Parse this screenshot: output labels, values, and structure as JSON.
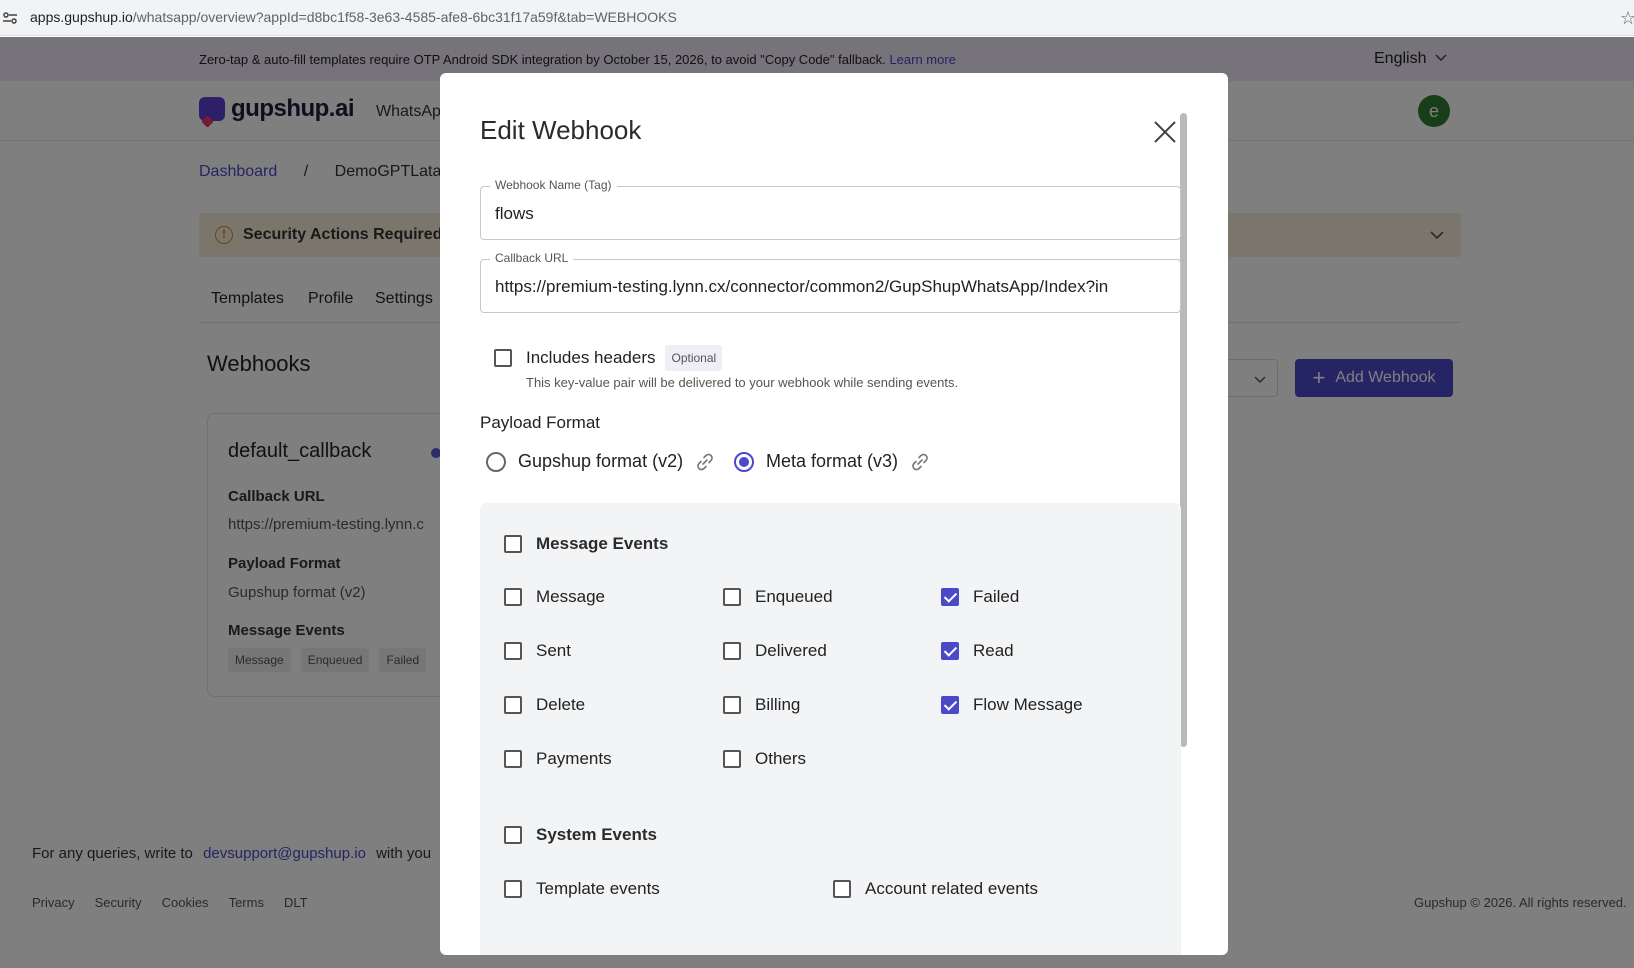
{
  "browser": {
    "url_host": "apps.gupshup.io",
    "url_path": "/whatsapp/overview?appId=d8bc1f58-3e63-4585-afe8-6bc31f17a59f&tab=WEBHOOKS"
  },
  "banner": {
    "message": "Zero-tap & auto-fill templates require OTP Android SDK integration by October 15, 2026, to avoid \"Copy Code\" fallback.",
    "link": "Learn more",
    "language": "English"
  },
  "nav": {
    "logo": "gupshup.ai",
    "link": "WhatsAp",
    "avatar_initial": "e"
  },
  "breadcrumb": {
    "root": "Dashboard",
    "separator": "/",
    "current": "DemoGPTLatan"
  },
  "security": {
    "label": "Security Actions Required"
  },
  "tabs": [
    "Templates",
    "Profile",
    "Settings"
  ],
  "webhooks": {
    "title": "Webhooks",
    "add_button": "Add Webhook",
    "card": {
      "name": "default_callback",
      "callback_label": "Callback URL",
      "callback_value": "https://premium-testing.lynn.c",
      "format_label": "Payload Format",
      "format_value": "Gupshup format (v2)",
      "events_label": "Message Events",
      "chips": [
        "Message",
        "Enqueued",
        "Failed"
      ]
    }
  },
  "footer": {
    "query_prefix": "For any queries, write to",
    "email": "devsupport@gupshup.io",
    "query_suffix": "with you",
    "links": [
      "Privacy",
      "Security",
      "Cookies",
      "Terms",
      "DLT"
    ],
    "copyright": "Gupshup © 2026. All rights reserved."
  },
  "modal": {
    "title": "Edit Webhook",
    "name_field": {
      "label": "Webhook Name (Tag)",
      "value": "flows"
    },
    "url_field": {
      "label": "Callback URL",
      "value": "https://premium-testing.lynn.cx/connector/common2/GupShupWhatsApp/Index?in"
    },
    "includes_headers": {
      "label": "Includes headers",
      "badge": "Optional",
      "checked": false,
      "hint": "This key-value pair will be delivered to your webhook while sending events."
    },
    "payload_format": {
      "label": "Payload Format",
      "options": [
        {
          "label": "Gupshup format (v2)",
          "selected": false
        },
        {
          "label": "Meta format (v3)",
          "selected": true
        }
      ]
    },
    "message_events": {
      "label": "Message Events",
      "checked": false,
      "items": [
        {
          "label": "Message",
          "checked": false
        },
        {
          "label": "Enqueued",
          "checked": false
        },
        {
          "label": "Failed",
          "checked": true
        },
        {
          "label": "Sent",
          "checked": false
        },
        {
          "label": "Delivered",
          "checked": false
        },
        {
          "label": "Read",
          "checked": true
        },
        {
          "label": "Delete",
          "checked": false
        },
        {
          "label": "Billing",
          "checked": false
        },
        {
          "label": "Flow Message",
          "checked": true
        },
        {
          "label": "Payments",
          "checked": false
        },
        {
          "label": "Others",
          "checked": false
        }
      ]
    },
    "system_events": {
      "label": "System Events",
      "checked": false,
      "items": [
        {
          "label": "Template events",
          "checked": false
        },
        {
          "label": "Account related events",
          "checked": false
        }
      ]
    }
  }
}
